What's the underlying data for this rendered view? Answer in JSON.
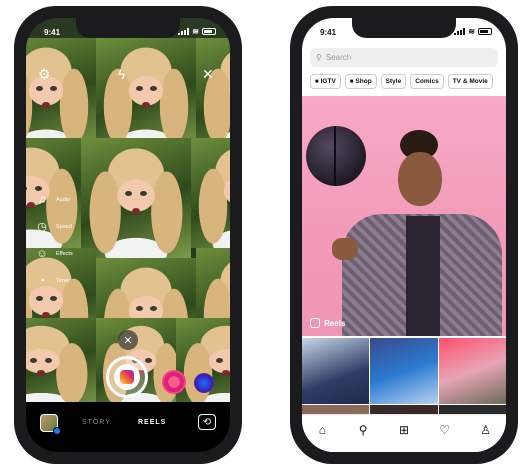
{
  "camera": {
    "status_time": "9:41",
    "tools": [
      {
        "icon": "music-note-icon",
        "glyph": "♫",
        "label": "Audio"
      },
      {
        "icon": "speed-icon",
        "glyph": "◷",
        "label": "Speed"
      },
      {
        "icon": "effects-icon",
        "glyph": "☺",
        "label": "Effects"
      },
      {
        "icon": "timer-icon",
        "glyph": "◔",
        "label": "Timer"
      }
    ],
    "modes": {
      "story": "STORY",
      "reels": "REELS"
    }
  },
  "explore": {
    "status_time": "9:41",
    "search_placeholder": "Search",
    "chips": [
      {
        "icon": "igtv-icon",
        "label": "IGTV"
      },
      {
        "icon": "shop-bag-icon",
        "label": "Shop"
      },
      {
        "icon": "",
        "label": "Style"
      },
      {
        "icon": "",
        "label": "Comics"
      },
      {
        "icon": "",
        "label": "TV & Movie"
      }
    ],
    "reels_label": "Reels",
    "tabs": [
      {
        "icon": "home-icon",
        "glyph": "⌂"
      },
      {
        "icon": "search-icon",
        "glyph": "⚲"
      },
      {
        "icon": "add-post-icon",
        "glyph": "⊞"
      },
      {
        "icon": "heart-icon",
        "glyph": "♡"
      },
      {
        "icon": "profile-icon",
        "glyph": "♙"
      }
    ]
  }
}
